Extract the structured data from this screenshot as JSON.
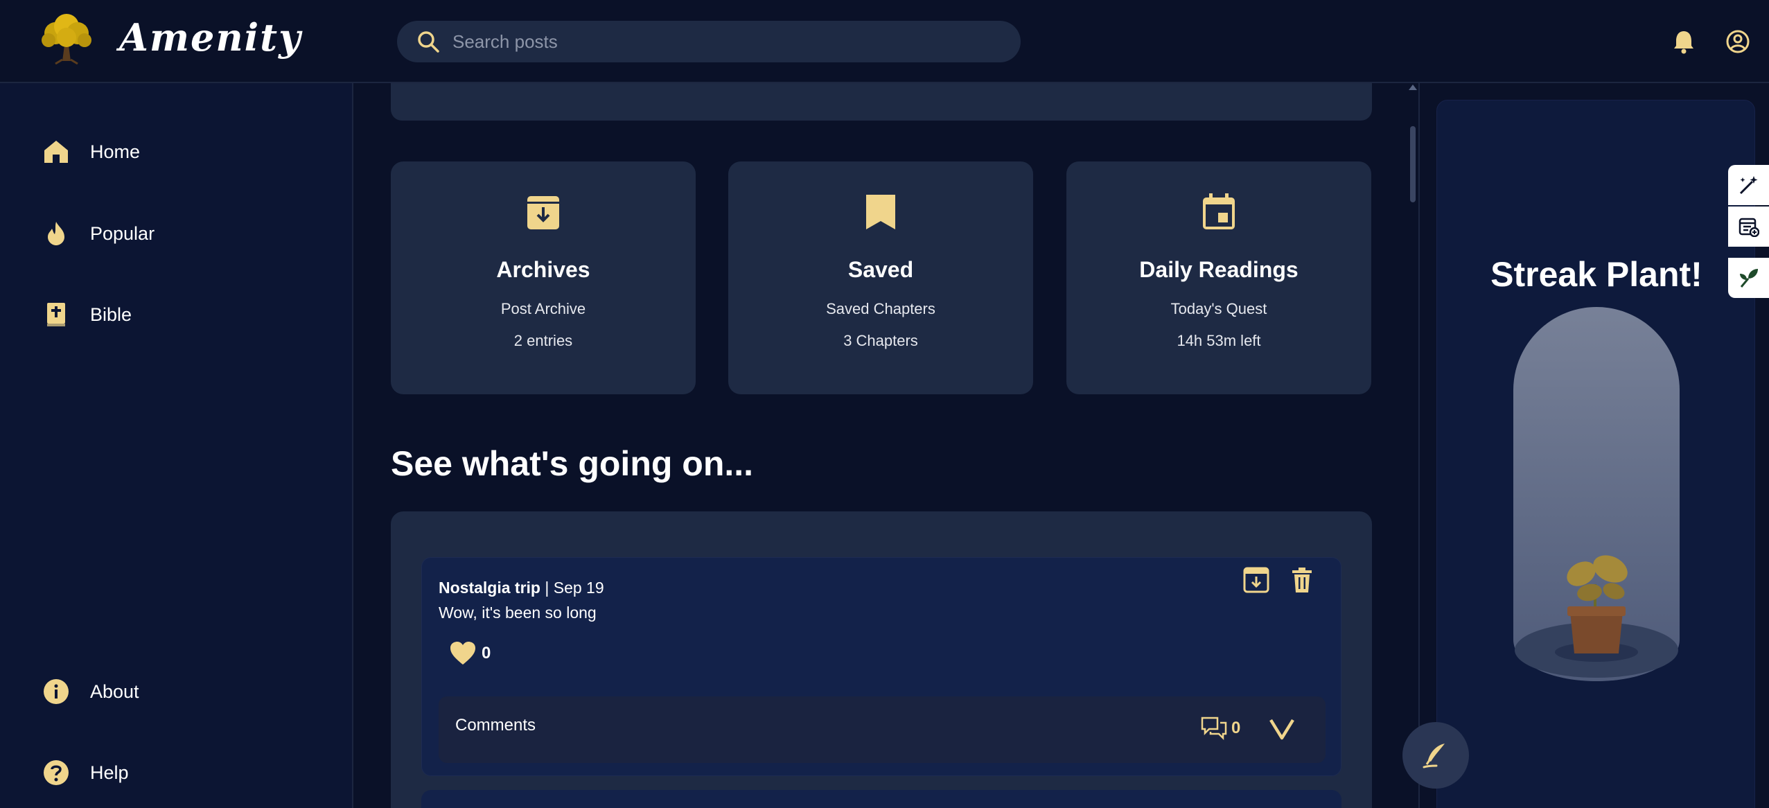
{
  "header": {
    "brand": "Amenity",
    "search_placeholder": "Search posts",
    "icons": [
      "tree-logo",
      "search-icon",
      "bell-icon",
      "account-icon"
    ]
  },
  "sidebar": {
    "items": [
      {
        "label": "Home",
        "icon": "home-icon"
      },
      {
        "label": "Popular",
        "icon": "flame-icon"
      },
      {
        "label": "Bible",
        "icon": "bible-icon"
      },
      {
        "label": "About",
        "icon": "info-icon"
      },
      {
        "label": "Help",
        "icon": "help-icon"
      }
    ]
  },
  "quick_cards": [
    {
      "title": "Archives",
      "subtitle": "Post Archive",
      "meta": "2 entries",
      "icon": "archive-icon"
    },
    {
      "title": "Saved",
      "subtitle": "Saved Chapters",
      "meta": "3 Chapters",
      "icon": "bookmark-icon"
    },
    {
      "title": "Daily Readings",
      "subtitle": "Today's Quest",
      "meta": "14h 53m left",
      "icon": "calendar-icon"
    }
  ],
  "feed": {
    "section_title": "See what's going on...",
    "posts": [
      {
        "title": "Nostalgia trip",
        "date": "Sep 19",
        "separator": " | ",
        "body": "Wow, it's been so long",
        "likes": "0",
        "comments_label": "Comments",
        "comments_count": "0"
      }
    ]
  },
  "right_panel": {
    "title": "Streak Plant!"
  },
  "colors": {
    "background": "#0a1128",
    "card": "#1e2a44",
    "accent": "#f0d58c",
    "post": "#13224a"
  }
}
